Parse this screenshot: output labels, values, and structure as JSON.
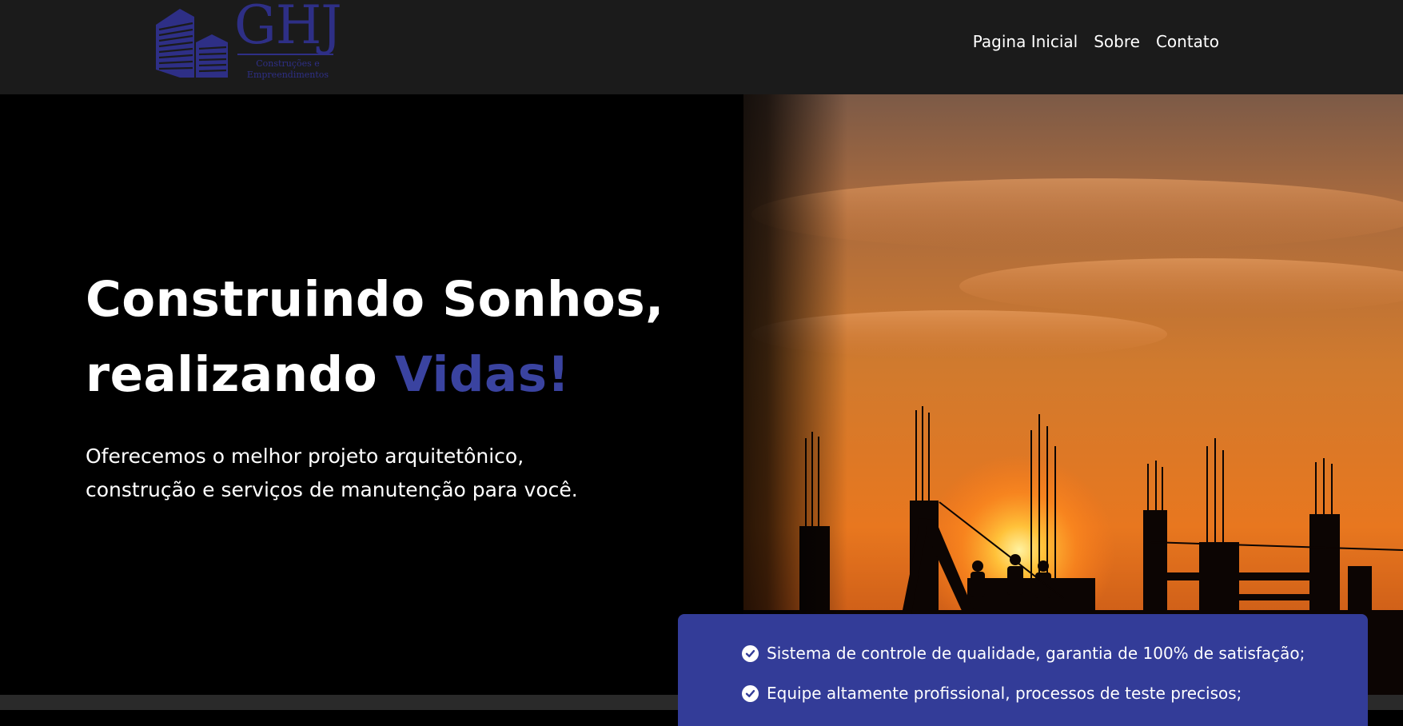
{
  "logo": {
    "mark": "GHJ",
    "subtitle_line1": "Construções e",
    "subtitle_line2": "Empreendimentos",
    "color": "#2e2f86"
  },
  "nav": {
    "items": [
      {
        "label": "Pagina Inicial"
      },
      {
        "label": "Sobre"
      },
      {
        "label": "Contato"
      }
    ]
  },
  "hero": {
    "title_line1": "Construindo Sonhos,",
    "title_line2_prefix": "realizando ",
    "title_line2_accent": "Vidas!",
    "subtitle_line1": "Oferecemos o melhor projeto arquitetônico,",
    "subtitle_line2": "construção e serviços de manutenção para você.",
    "accent_color": "#3a43a0"
  },
  "features": {
    "items": [
      {
        "text": "Sistema de controle de qualidade, garantia de 100% de satisfação;"
      },
      {
        "text": "Equipe altamente profissional, processos de teste precisos;"
      }
    ],
    "background": "#333c98"
  },
  "icons": {
    "logo": "buildings-icon",
    "feature_bullet": "check-circle-icon"
  },
  "colors": {
    "header_bg": "#1b1b1b",
    "hero_bg": "#000000",
    "text": "#ffffff"
  }
}
